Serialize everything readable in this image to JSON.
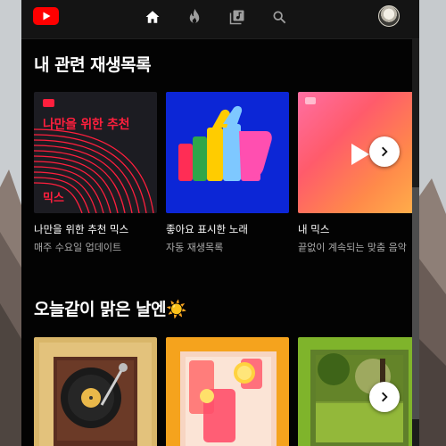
{
  "app": {
    "name": "YouTube Music"
  },
  "topbar": {
    "nav": [
      {
        "icon": "home-icon"
      },
      {
        "icon": "hot-icon"
      },
      {
        "icon": "library-icon"
      },
      {
        "icon": "search-icon"
      }
    ]
  },
  "sections": [
    {
      "title": "내 관련 재생목록",
      "cards": [
        {
          "title": "나만을 위한 추천 믹스",
          "subtitle": "매주 수요일 업데이트",
          "art_text": "나만을 위한 추천",
          "art_mix": "믹스"
        },
        {
          "title": "좋아요 표시한 노래",
          "subtitle": "자동 재생목록"
        },
        {
          "title": "내 믹스",
          "subtitle": "끝없이 계속되는 맞춤 음악"
        }
      ]
    },
    {
      "title": "오늘같이 맑은 날엔☀️",
      "cards": [
        {
          "title": ""
        },
        {
          "title": ""
        },
        {
          "title": ""
        }
      ]
    }
  ],
  "colors": {
    "brand_red": "#ff0000",
    "background": "#030303",
    "topbar": "#141414",
    "liked_blue": "#0c26d6"
  }
}
